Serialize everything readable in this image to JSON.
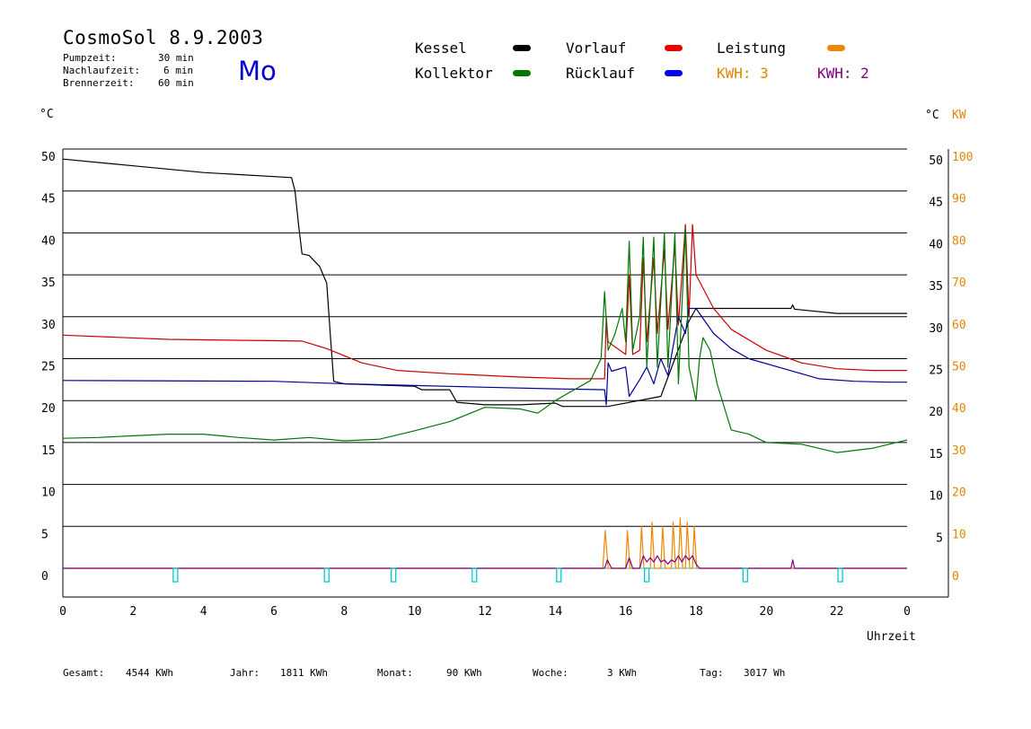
{
  "header": {
    "title": "CosmoSol 8.9.2003",
    "day": "Mo",
    "params": [
      {
        "label": "Pumpzeit:",
        "value": "30 min"
      },
      {
        "label": "Nachlaufzeit:",
        "value": "6 min"
      },
      {
        "label": "Brennerzeit:",
        "value": "60 min"
      }
    ]
  },
  "legend": {
    "kessel": "Kessel",
    "kollektor": "Kollektor",
    "vorlauf": "Vorlauf",
    "ruecklauf": "Rücklauf",
    "leistung": "Leistung",
    "kwh1": "KWH: 3",
    "kwh2": "KWH: 2"
  },
  "axis": {
    "left_unit": "°C",
    "right_unit": "°C",
    "right_unit2": "KW",
    "xlabel": "Uhrzeit"
  },
  "footer": [
    {
      "label": "Gesamt:",
      "value": "4544 KWh"
    },
    {
      "label": "Jahr:",
      "value": "1811 KWh"
    },
    {
      "label": "Monat:",
      "value": "90 KWh"
    },
    {
      "label": "Woche:",
      "value": "3 KWh"
    },
    {
      "label": "Tag:",
      "value": "3017 Wh"
    }
  ],
  "colors": {
    "kessel": "#000000",
    "kollektor": "#007700",
    "vorlauf": "#cc0000",
    "ruecklauf": "#000099",
    "leistung": "#ee8800",
    "kwh2": "#800080",
    "pump": "#00cccc",
    "orange_text": "#dd8800",
    "purple_text": "#800080"
  },
  "chart_data": {
    "type": "line",
    "xlabel": "Uhrzeit",
    "x_ticks": [
      "0",
      "2",
      "4",
      "6",
      "8",
      "10",
      "12",
      "14",
      "16",
      "18",
      "20",
      "22",
      "0"
    ],
    "xlim": [
      0,
      24
    ],
    "ylim": [
      0,
      50
    ],
    "y_ticks_left": [
      "50",
      "45",
      "40",
      "35",
      "30",
      "25",
      "20",
      "15",
      "10",
      "5",
      "0"
    ],
    "y_ticks_right": [
      "50",
      "45",
      "40",
      "35",
      "30",
      "25",
      "20",
      "15",
      "10",
      "5"
    ],
    "y2lim": [
      0,
      100
    ],
    "y2_ticks": [
      "100",
      "90",
      "80",
      "70",
      "60",
      "50",
      "40",
      "30",
      "20",
      "10",
      "0"
    ],
    "grid": true,
    "series": [
      {
        "name": "Kessel",
        "color": "#000000",
        "points": [
          [
            0,
            48.8
          ],
          [
            2,
            48
          ],
          [
            4,
            47.2
          ],
          [
            6.5,
            46.6
          ],
          [
            6.6,
            45
          ],
          [
            6.7,
            41
          ],
          [
            6.8,
            37.5
          ],
          [
            7,
            37.3
          ],
          [
            7.3,
            36
          ],
          [
            7.5,
            34
          ],
          [
            7.6,
            28
          ],
          [
            7.7,
            22.3
          ],
          [
            8,
            22
          ],
          [
            10,
            21.7
          ],
          [
            10.2,
            21.3
          ],
          [
            11,
            21.3
          ],
          [
            11.2,
            19.8
          ],
          [
            12,
            19.5
          ],
          [
            13,
            19.5
          ],
          [
            14,
            19.7
          ],
          [
            14.2,
            19.3
          ],
          [
            15.5,
            19.3
          ],
          [
            17,
            20.5
          ],
          [
            17.8,
            29.5
          ],
          [
            18,
            31
          ],
          [
            20,
            31
          ],
          [
            20.7,
            31
          ],
          [
            20.75,
            31.4
          ],
          [
            20.8,
            30.9
          ],
          [
            22,
            30.4
          ],
          [
            24,
            30.4
          ]
        ]
      },
      {
        "name": "Vorlauf",
        "color": "#cc0000",
        "points": [
          [
            0,
            27.8
          ],
          [
            3,
            27.3
          ],
          [
            6.8,
            27.1
          ],
          [
            7.5,
            26.2
          ],
          [
            8.5,
            24.5
          ],
          [
            9.5,
            23.6
          ],
          [
            11,
            23.2
          ],
          [
            13,
            22.8
          ],
          [
            14.5,
            22.6
          ],
          [
            15.4,
            22.6
          ],
          [
            15.45,
            30
          ],
          [
            15.5,
            27
          ],
          [
            16,
            25.5
          ],
          [
            16.1,
            35
          ],
          [
            16.2,
            25.5
          ],
          [
            16.4,
            26
          ],
          [
            16.5,
            37
          ],
          [
            16.6,
            27
          ],
          [
            16.8,
            37
          ],
          [
            16.9,
            28
          ],
          [
            17.1,
            38
          ],
          [
            17.2,
            28.5
          ],
          [
            17.4,
            38.5
          ],
          [
            17.5,
            29
          ],
          [
            17.7,
            41
          ],
          [
            17.8,
            30
          ],
          [
            17.9,
            41
          ],
          [
            18,
            35
          ],
          [
            18.5,
            31
          ],
          [
            19,
            28.5
          ],
          [
            20,
            26
          ],
          [
            21,
            24.5
          ],
          [
            22,
            23.8
          ],
          [
            23,
            23.6
          ],
          [
            24,
            23.6
          ]
        ]
      },
      {
        "name": "Rücklauf",
        "color": "#000099",
        "points": [
          [
            0,
            22.4
          ],
          [
            6,
            22.3
          ],
          [
            8,
            22
          ],
          [
            10,
            21.8
          ],
          [
            12,
            21.6
          ],
          [
            14,
            21.4
          ],
          [
            15.4,
            21.3
          ],
          [
            15.45,
            19.5
          ],
          [
            15.5,
            24.5
          ],
          [
            15.6,
            23.5
          ],
          [
            16,
            24
          ],
          [
            16.1,
            20.5
          ],
          [
            16.4,
            22.5
          ],
          [
            16.6,
            24
          ],
          [
            16.8,
            22
          ],
          [
            17,
            25
          ],
          [
            17.2,
            23
          ],
          [
            17.5,
            30
          ],
          [
            17.7,
            28
          ],
          [
            17.8,
            31
          ],
          [
            18,
            31
          ],
          [
            18.5,
            28
          ],
          [
            19,
            26.2
          ],
          [
            19.5,
            25
          ],
          [
            20.5,
            23.8
          ],
          [
            21.5,
            22.6
          ],
          [
            22.5,
            22.3
          ],
          [
            23.5,
            22.2
          ],
          [
            24,
            22.2
          ]
        ]
      },
      {
        "name": "Kollektor",
        "color": "#007700",
        "points": [
          [
            0,
            15.5
          ],
          [
            1,
            15.6
          ],
          [
            2,
            15.8
          ],
          [
            3,
            16
          ],
          [
            4,
            16
          ],
          [
            5,
            15.6
          ],
          [
            6,
            15.3
          ],
          [
            7,
            15.6
          ],
          [
            8,
            15.2
          ],
          [
            8.5,
            15.3
          ],
          [
            9,
            15.4
          ],
          [
            10,
            16.4
          ],
          [
            11,
            17.5
          ],
          [
            12,
            19.2
          ],
          [
            13,
            19
          ],
          [
            13.5,
            18.5
          ],
          [
            14,
            20
          ],
          [
            15,
            22.4
          ],
          [
            15.3,
            25
          ],
          [
            15.4,
            33
          ],
          [
            15.5,
            26
          ],
          [
            15.7,
            28
          ],
          [
            15.9,
            31
          ],
          [
            16,
            27
          ],
          [
            16.1,
            39
          ],
          [
            16.2,
            26
          ],
          [
            16.4,
            30
          ],
          [
            16.5,
            39.5
          ],
          [
            16.6,
            24
          ],
          [
            16.8,
            39.5
          ],
          [
            16.9,
            24
          ],
          [
            17.1,
            40
          ],
          [
            17.2,
            24
          ],
          [
            17.4,
            40
          ],
          [
            17.5,
            22
          ],
          [
            17.7,
            40.5
          ],
          [
            17.8,
            24
          ],
          [
            18,
            20
          ],
          [
            18.1,
            25
          ],
          [
            18.2,
            27.5
          ],
          [
            18.4,
            26
          ],
          [
            18.6,
            22
          ],
          [
            19,
            16.5
          ],
          [
            19.5,
            16
          ],
          [
            20,
            15
          ],
          [
            21,
            14.8
          ],
          [
            22,
            13.8
          ],
          [
            23,
            14.3
          ],
          [
            24,
            15.3
          ]
        ]
      },
      {
        "name": "Leistung",
        "color": "#ee8800",
        "axis": "right",
        "points": [
          [
            0,
            0
          ],
          [
            15.35,
            0
          ],
          [
            15.42,
            9
          ],
          [
            15.5,
            0
          ],
          [
            16,
            0
          ],
          [
            16.05,
            9
          ],
          [
            16.12,
            0
          ],
          [
            16.4,
            0
          ],
          [
            16.45,
            10
          ],
          [
            16.52,
            0
          ],
          [
            16.7,
            0
          ],
          [
            16.75,
            11
          ],
          [
            16.82,
            0
          ],
          [
            17,
            0
          ],
          [
            17.05,
            10
          ],
          [
            17.12,
            0
          ],
          [
            17.3,
            0
          ],
          [
            17.35,
            11
          ],
          [
            17.42,
            0
          ],
          [
            17.5,
            0
          ],
          [
            17.55,
            12
          ],
          [
            17.62,
            0
          ],
          [
            17.7,
            0
          ],
          [
            17.75,
            11
          ],
          [
            17.82,
            0
          ],
          [
            17.9,
            0
          ],
          [
            17.95,
            10
          ],
          [
            18.02,
            0
          ],
          [
            24,
            0
          ]
        ]
      },
      {
        "name": "KWH: 2",
        "color": "#800080",
        "axis": "right",
        "points": [
          [
            0,
            0
          ],
          [
            15.4,
            0
          ],
          [
            15.48,
            2
          ],
          [
            15.6,
            0
          ],
          [
            16,
            0
          ],
          [
            16.1,
            2.5
          ],
          [
            16.2,
            0
          ],
          [
            16.4,
            0
          ],
          [
            16.5,
            3
          ],
          [
            16.6,
            1.5
          ],
          [
            16.7,
            2.5
          ],
          [
            16.8,
            1.5
          ],
          [
            16.9,
            3
          ],
          [
            17,
            1.5
          ],
          [
            17.1,
            2
          ],
          [
            17.2,
            1
          ],
          [
            17.3,
            2
          ],
          [
            17.4,
            1.5
          ],
          [
            17.5,
            3
          ],
          [
            17.6,
            1.5
          ],
          [
            17.7,
            3
          ],
          [
            17.8,
            2
          ],
          [
            17.9,
            3
          ],
          [
            18,
            1
          ],
          [
            18.1,
            0
          ],
          [
            20.7,
            0
          ],
          [
            20.75,
            2
          ],
          [
            20.8,
            0
          ],
          [
            24,
            0
          ]
        ]
      }
    ],
    "pump_marks": [
      3.2,
      7.5,
      9.4,
      11.7,
      14.1,
      16.6,
      19.4,
      22.1
    ]
  }
}
